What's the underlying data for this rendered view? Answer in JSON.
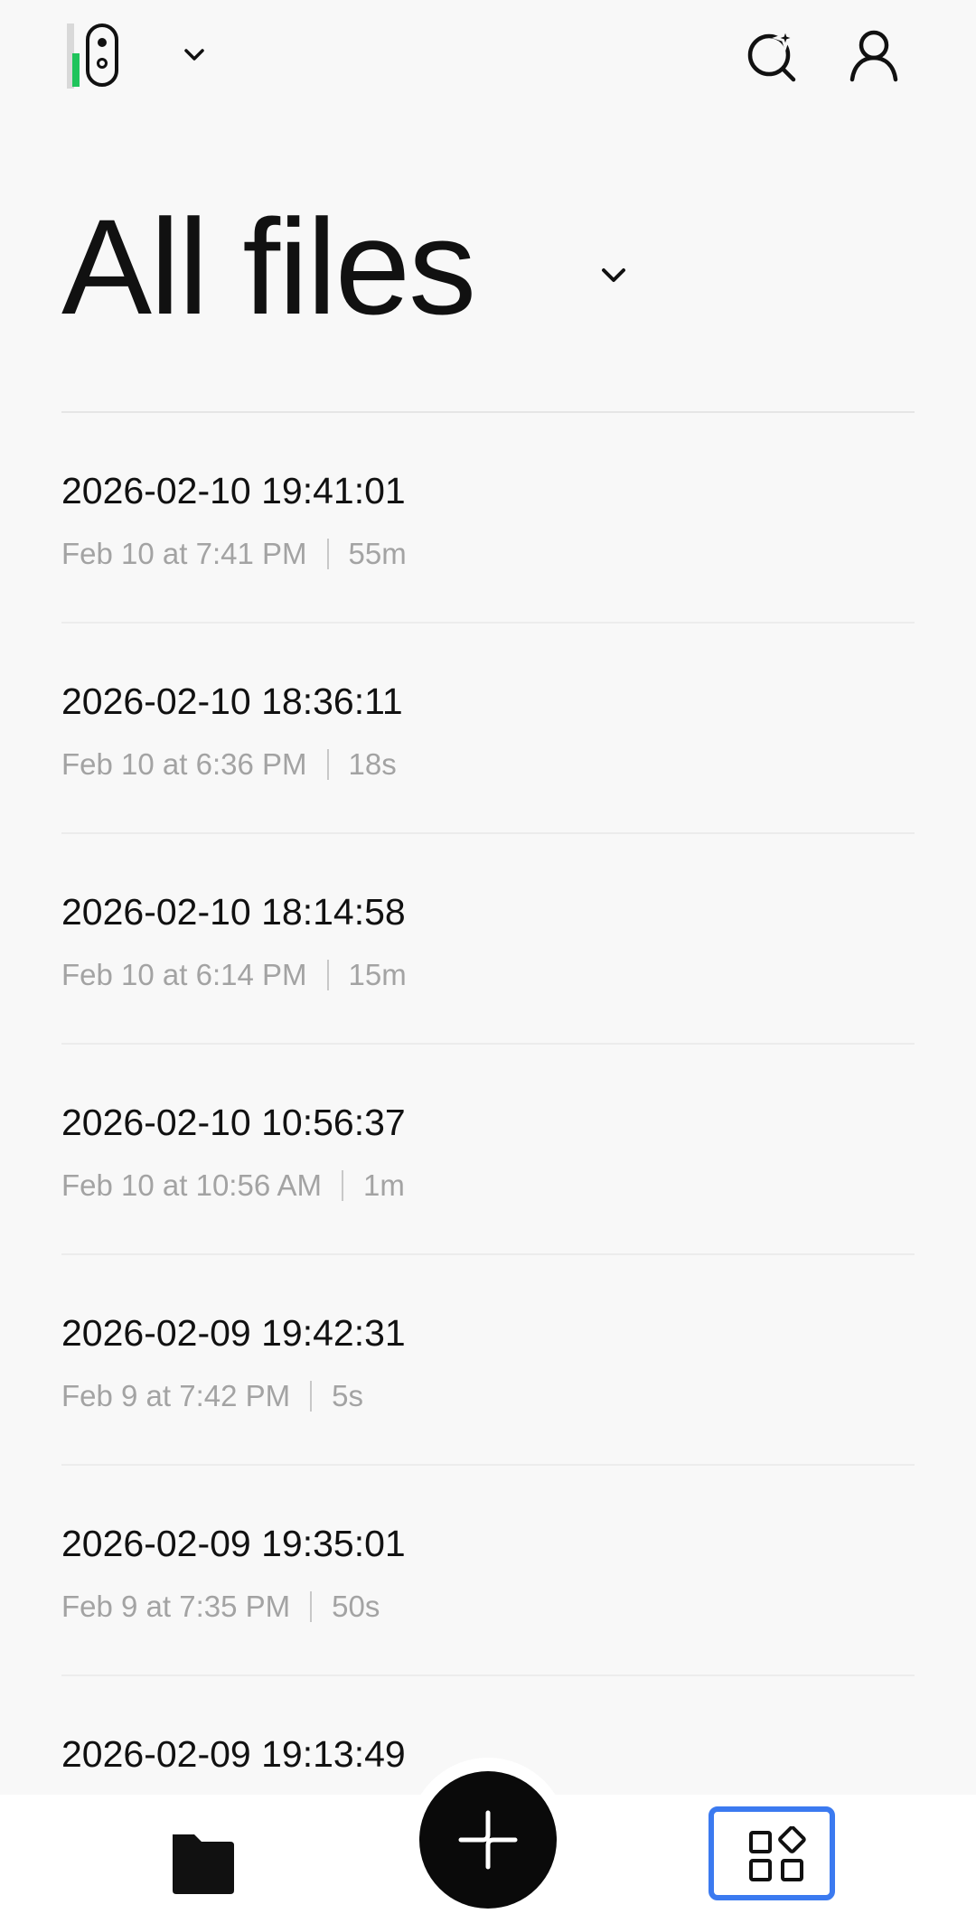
{
  "header": {
    "device_icon": "earbuds-device-icon",
    "battery_level": 0.55,
    "battery_color": "#1fc45b",
    "device_dropdown_icon": "chevron-down-icon",
    "search_icon": "ai-search-icon",
    "account_icon": "user-icon"
  },
  "page": {
    "title": "All files",
    "title_dropdown_icon": "chevron-down-icon"
  },
  "files": [
    {
      "name": "2026-02-10 19:41:01",
      "date": "Feb 10 at 7:41 PM",
      "duration": "55m"
    },
    {
      "name": "2026-02-10 18:36:11",
      "date": "Feb 10 at 6:36 PM",
      "duration": "18s"
    },
    {
      "name": "2026-02-10 18:14:58",
      "date": "Feb 10 at 6:14 PM",
      "duration": "15m"
    },
    {
      "name": "2026-02-10 10:56:37",
      "date": "Feb 10 at 10:56 AM",
      "duration": "1m"
    },
    {
      "name": "2026-02-09 19:42:31",
      "date": "Feb 9 at 7:42 PM",
      "duration": "5s"
    },
    {
      "name": "2026-02-09 19:35:01",
      "date": "Feb 9 at 7:35 PM",
      "duration": "50s"
    },
    {
      "name": "2026-02-09 19:13:49"
    }
  ],
  "bottom_nav": {
    "files_icon": "folder-icon",
    "record_icon": "sparkle-plus-icon",
    "apps_icon": "apps-grid-icon",
    "accent_color": "#3b7af0"
  }
}
